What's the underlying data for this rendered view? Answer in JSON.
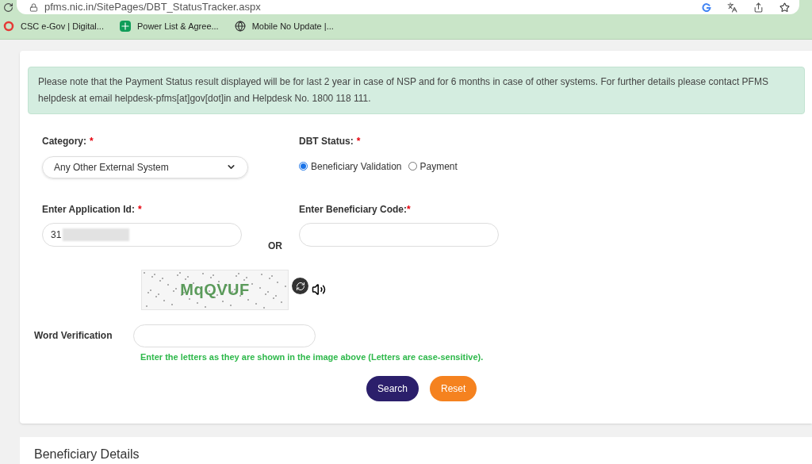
{
  "browser": {
    "url": "pfms.nic.in/SitePages/DBT_StatusTracker.aspx",
    "bookmarks": [
      {
        "label": "CSC e-Gov | Digital..."
      },
      {
        "label": "Power List & Agree..."
      },
      {
        "label": "Mobile No Update |..."
      }
    ]
  },
  "notice": "Please note that the Payment Status result displayed will be for last 2 year in case of NSP and for 6 months in case of other systems. For further details please contact PFMS helpdesk at email helpdesk-pfms[at]gov[dot]in and Helpdesk No. 1800 118 111.",
  "category": {
    "label": "Category:",
    "required": "*",
    "value": "Any Other External System"
  },
  "dbt_status": {
    "label": "DBT Status:",
    "required": "*",
    "options": [
      {
        "label": "Beneficiary Validation",
        "selected": true
      },
      {
        "label": "Payment",
        "selected": false
      }
    ]
  },
  "application_id": {
    "label": "Enter Application Id:",
    "required": "*",
    "value": "31"
  },
  "or_text": "OR",
  "beneficiary_code": {
    "label": "Enter Beneficiary Code:",
    "required": "*"
  },
  "captcha": {
    "text": "MqQVUF"
  },
  "word_verification": {
    "label": "Word Verification",
    "hint": "Enter the letters as they are shown in the image above (Letters are case-sensitive)."
  },
  "buttons": [
    {
      "label": "Search",
      "kind": "primary"
    },
    {
      "label": "Reset",
      "kind": "secondary"
    }
  ],
  "section_title": "Beneficiary Details"
}
